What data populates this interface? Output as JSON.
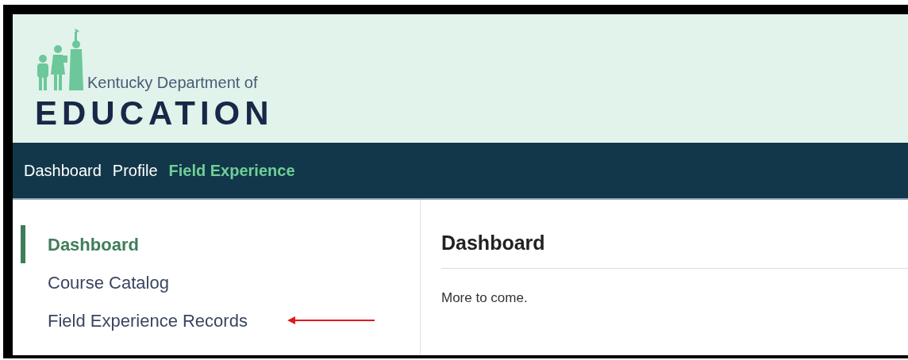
{
  "header": {
    "logo_line_1": "Kentucky Department of",
    "logo_line_2": "EDUCATION"
  },
  "nav": [
    {
      "label": "Dashboard",
      "selected": false
    },
    {
      "label": "Profile",
      "selected": false
    },
    {
      "label": "Field Experience",
      "selected": true
    }
  ],
  "sidebar": {
    "items": [
      {
        "label": "Dashboard",
        "selected": true
      },
      {
        "label": "Course Catalog",
        "selected": false
      },
      {
        "label": "Field Experience Records",
        "selected": false
      }
    ]
  },
  "main": {
    "title": "Dashboard",
    "body": "More to come."
  }
}
